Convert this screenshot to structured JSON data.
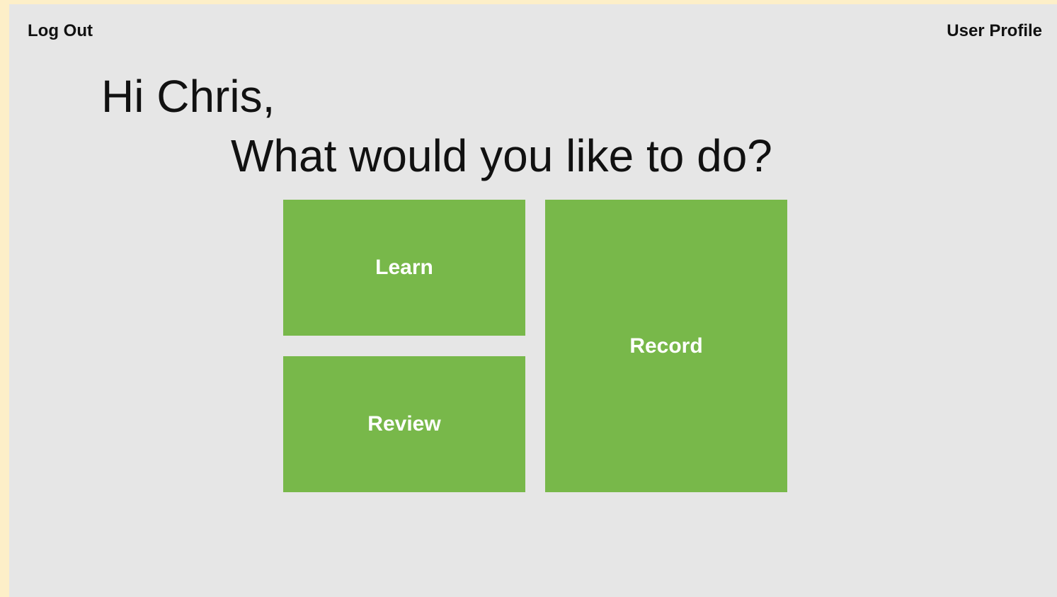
{
  "header": {
    "logout_label": "Log Out",
    "profile_label": "User Profile"
  },
  "main": {
    "greeting": "Hi Chris,",
    "question": "What would you like to do?",
    "tiles": [
      {
        "label": "Learn"
      },
      {
        "label": "Review"
      },
      {
        "label": "Record"
      }
    ]
  },
  "colors": {
    "tile_bg": "#78b84a",
    "page_bg": "#e6e6e6",
    "frame_bg": "#fdefc8"
  }
}
